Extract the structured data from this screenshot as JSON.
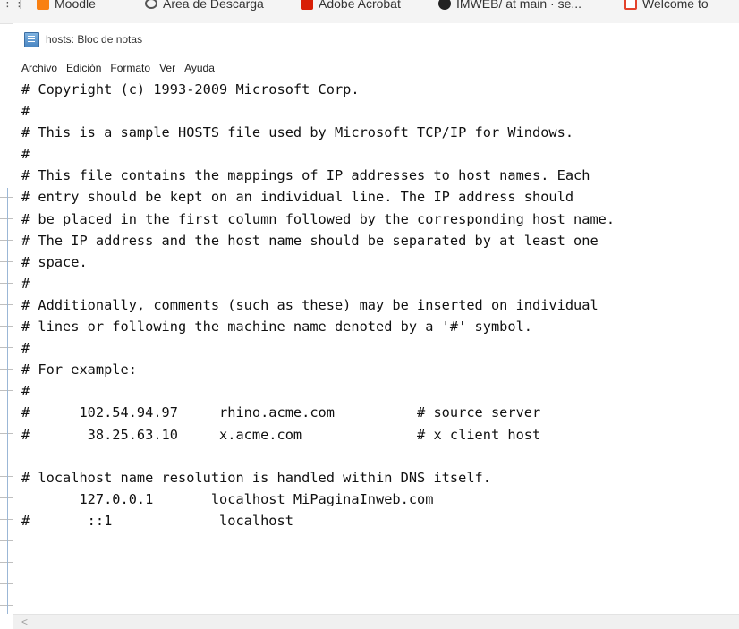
{
  "bookmarks": [
    {
      "label": "Moodle",
      "icon": "moodle-icon"
    },
    {
      "label": "Area de Descarga",
      "icon": "download-area-icon"
    },
    {
      "label": "Adobe Acrobat",
      "icon": "acrobat-icon"
    },
    {
      "label": "IMWEB/ at main · se...",
      "icon": "github-icon"
    },
    {
      "label": "Welcome to",
      "icon": "welcome-icon"
    }
  ],
  "window": {
    "title": "hosts: Bloc de notas"
  },
  "menu": [
    "Archivo",
    "Edición",
    "Formato",
    "Ver",
    "Ayuda"
  ],
  "document": {
    "lines": [
      "# Copyright (c) 1993-2009 Microsoft Corp.",
      "#",
      "# This is a sample HOSTS file used by Microsoft TCP/IP for Windows.",
      "#",
      "# This file contains the mappings of IP addresses to host names. Each",
      "# entry should be kept on an individual line. The IP address should",
      "# be placed in the first column followed by the corresponding host name.",
      "# The IP address and the host name should be separated by at least one",
      "# space.",
      "#",
      "# Additionally, comments (such as these) may be inserted on individual",
      "# lines or following the machine name denoted by a '#' symbol.",
      "#",
      "# For example:",
      "#",
      "#      102.54.94.97     rhino.acme.com          # source server",
      "#       38.25.63.10     x.acme.com              # x client host",
      "",
      "# localhost name resolution is handled within DNS itself.",
      "       127.0.0.1       localhost MiPaginaInweb.com",
      "#       ::1             localhost"
    ]
  },
  "scrollbar": {
    "left_arrow": "<"
  }
}
